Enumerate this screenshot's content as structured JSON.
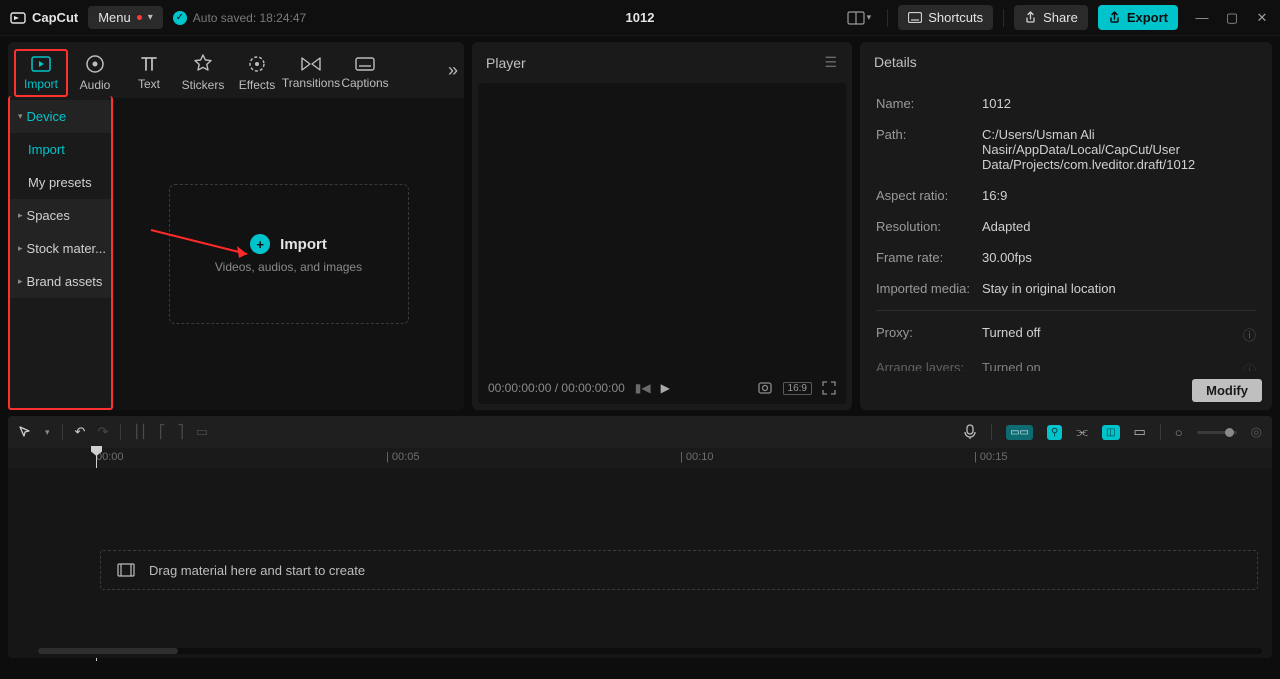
{
  "titlebar": {
    "brand": "CapCut",
    "menu_label": "Menu",
    "autosave": "Auto saved: 18:24:47",
    "project_title": "1012",
    "shortcuts": "Shortcuts",
    "share": "Share",
    "export": "Export"
  },
  "tabs": {
    "import": "Import",
    "audio": "Audio",
    "text": "Text",
    "stickers": "Stickers",
    "effects": "Effects",
    "transitions": "Transitions",
    "captions": "Captions"
  },
  "side": {
    "device": "Device",
    "import": "Import",
    "presets": "My presets",
    "spaces": "Spaces",
    "stock": "Stock mater...",
    "brand": "Brand assets"
  },
  "drop": {
    "title": "Import",
    "subtitle": "Videos, audios, and images"
  },
  "player": {
    "title": "Player",
    "time": "00:00:00:00 / 00:00:00:00",
    "ratio": "16:9"
  },
  "details": {
    "title": "Details",
    "name_k": "Name:",
    "name_v": "1012",
    "path_k": "Path:",
    "path_v": "C:/Users/Usman Ali Nasir/AppData/Local/CapCut/User Data/Projects/com.lveditor.draft/1012",
    "aspect_k": "Aspect ratio:",
    "aspect_v": "16:9",
    "res_k": "Resolution:",
    "res_v": "Adapted",
    "fps_k": "Frame rate:",
    "fps_v": "30.00fps",
    "imp_k": "Imported media:",
    "imp_v": "Stay in original location",
    "proxy_k": "Proxy:",
    "proxy_v": "Turned off",
    "arr_k": "Arrange layers:",
    "arr_v": "Turned on",
    "modify": "Modify"
  },
  "timeline": {
    "m0": "00:00",
    "m1": "| 00:05",
    "m2": "| 00:10",
    "m3": "| 00:15",
    "hint": "Drag material here and start to create"
  }
}
